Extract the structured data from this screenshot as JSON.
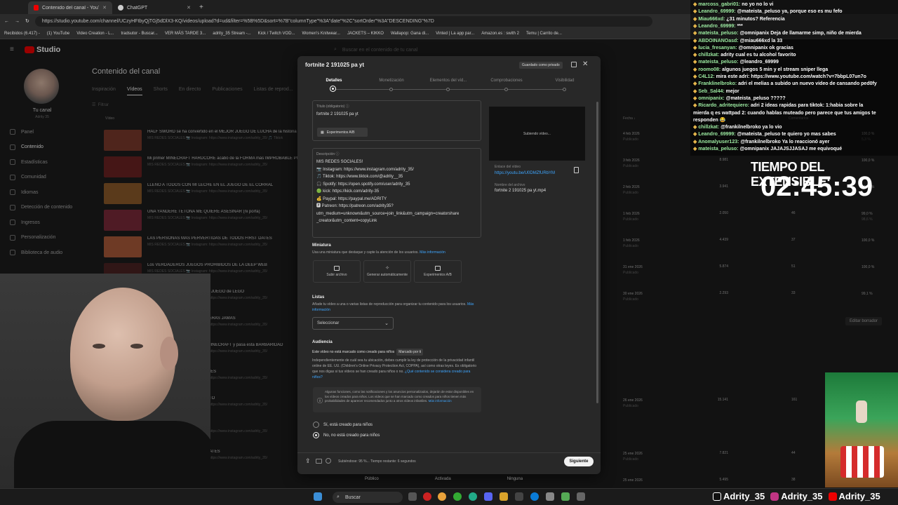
{
  "browser": {
    "tabs": [
      {
        "label": "Contenido del canal - YouTube St",
        "active": true
      },
      {
        "label": "ChatGPT",
        "active": false
      }
    ],
    "url": "https://studio.youtube.com/channel/UCzyHFtbyQjTGj5dDlX3-KQ/videos/upload?d=ud&filter=%5B%5D&sort=%7B\"columnType\"%3A\"date\"%2C\"sortOrder\"%3A\"DESCENDING\"%7D",
    "bookmarks": [
      "Recibidos (6.417) -",
      "(1) YouTube",
      "Video Creation - L...",
      "tradsutor - Buscar...",
      "VER MÁS TARDE 3...",
      "adrity_35 Stream -...",
      "Kick / Twitch VOD...",
      "Women's Knitwear...",
      "JACKETS – KIKKO",
      "Wallapop: Gana di...",
      "Vinted | La app par...",
      "Amazon.es : swith 2",
      "Temu | Carrito de..."
    ]
  },
  "studio": {
    "logo": "Studio",
    "search_placeholder": "Buscar en el contenido de tu canal",
    "channel_label": "Tu canal",
    "channel_name": "Adrity 35",
    "nav": [
      "Panel",
      "Contenido",
      "Estadísticas",
      "Comunidad",
      "Idiomas",
      "Detección de contenido",
      "Ingresos",
      "Personalización",
      "Biblioteca de audio"
    ],
    "page_title": "Contenido del canal",
    "subtabs": [
      "Inspiración",
      "Vídeos",
      "Shorts",
      "En directo",
      "Publicaciones",
      "Listas de reprod..."
    ],
    "filter_placeholder": "Filtrar",
    "col_video": "Vídeo",
    "col_date": "Fecha",
    "col_comments": "Comentarios",
    "edit_draft": "Editar borrador",
    "footer": [
      "Público",
      "Activada",
      "Ninguna"
    ],
    "videos": [
      {
        "title": "HALF SWORD se ha convertido en el MEJOR JUEGO DE LUCHA de la historia",
        "desc": "MIS REDES SOCIALES 📷 Instagram: https://www.instagram.com/adrity_35/ 🎵 Tiktok",
        "date": "4 feb 2026",
        "status": "Publicado",
        "views": "",
        "comments": "",
        "pct": "100,0 %",
        "pct_sub": "5,3 %",
        "thumb": "#7a3a2c",
        "duration": "23:56"
      },
      {
        "title": "Mi primer MINECRAFT HARDCORE acabó de la FORMA más IMPROBABLE POSIBLE",
        "desc": "MIS REDES SOCIALES 📷 Instagram: https://www.instagram.com/adrity_35/",
        "date": "3 feb 2026",
        "status": "Publicado",
        "views": "8.981",
        "comments": "",
        "pct": "100,0 %",
        "pct_sub": "",
        "thumb": "#6a2222",
        "duration": "1:08:42"
      },
      {
        "title": "LLENO A TODOS CON MI LECHE EN EL JUEGO DE EL CORRAL",
        "desc": "MIS REDES SOCIALES 📷 Instagram: https://www.instagram.com/adrity_35/",
        "date": "2 feb 2026",
        "status": "Publicado",
        "views": "3.941",
        "comments": "",
        "pct": "100,0 %",
        "pct_sub": "",
        "thumb": "#8a5a2a",
        "duration": "1:32:02"
      },
      {
        "title": "UNA YANDERE TETONA ME QUIERE ASESINAR (ni porfa)",
        "desc": "MIS REDES SOCIALES 📷 Instagram: https://www.instagram.com/adrity_35/",
        "date": "1 feb 2026",
        "status": "Publicado",
        "views": "2.050",
        "comments": "46",
        "pct": "99,0 %",
        "pct_sub": "98,6 %",
        "thumb": "#7a2a3a",
        "duration": "21:33"
      },
      {
        "title": "LAS PERSONAS MÁS PERVERTIDAS DE TODOS FIRST DATES",
        "desc": "MIS REDES SOCIALES 📷 Instagram: https://www.instagram.com/adrity_35/",
        "date": "1 feb 2026",
        "status": "Publicado",
        "views": "4.439",
        "comments": "37",
        "pct": "100,0 %",
        "pct_sub": "",
        "thumb": "#aa5a3a",
        "duration": "23:12"
      },
      {
        "title": "Los VERDADEROS JUEGOS PROHIBIDOS DE LA DEEP WEB",
        "desc": "MIS REDES SOCIALES 📷 Instagram: https://www.instagram.com/adrity_35/",
        "date": "31 ene 2026",
        "status": "Publicado",
        "views": "5.874",
        "comments": "51",
        "pct": "100,0 %",
        "pct_sub": "",
        "thumb": "#4a2222",
        "duration": "30:51"
      },
      {
        "title": "CAOS y DELINCUENCIA en este JUEGO de LEGO",
        "desc": "MIS REDES SOCIALES 📷 Instagram: https://www.instagram.com/adrity_35/",
        "date": "30 ene 2026",
        "status": "Publicado",
        "views": "2.293",
        "comments": "33",
        "pct": "99,1 %",
        "pct_sub": "",
        "thumb": "#5a4a2a",
        "duration": ""
      },
      {
        "title": "ROBOTS MÁS TENSIAS QUE VERÁS JAMÁS",
        "desc": "MIS REDES SOCIALES 📷 Instagram: https://www.instagram.com/adrity_35/",
        "date": "",
        "status": "",
        "views": "",
        "comments": "",
        "pct": "",
        "pct_sub": "",
        "thumb": "#333",
        "duration": ""
      },
      {
        "title": "PARA VER SI ES MEJOR QUE MINECRAFT y pasa esta BARBARIDAD",
        "desc": "MIS REDES SOCIALES 📷 Instagram: https://www.instagram.com/adrity_35/",
        "date": "",
        "status": "",
        "views": "",
        "comments": "",
        "pct": "",
        "pct_sub": "",
        "thumb": "#333",
        "duration": ""
      },
      {
        "title": "LOCA QUE HE IDO A FIRST DATES",
        "desc": "MIS REDES SOCIALES 📷 Instagram: https://www.instagram.com/adrity_35/",
        "date": "",
        "status": "",
        "views": "",
        "comments": "",
        "pct": "",
        "pct_sub": "",
        "thumb": "#333",
        "duration": ""
      },
      {
        "title": "HAKEAR CHAT GPT Y PASA ESTO",
        "desc": "MIS REDES SOCIALES 📷 Instagram: https://www.instagram.com/adrity_35/",
        "date": "26 ene 2026",
        "status": "Publicado",
        "views": "15.141",
        "comments": "161",
        "pct": "100,0 %",
        "pct_sub": "",
        "thumb": "#333",
        "duration": ""
      },
      {
        "title": "FSS demasiado BUENO",
        "desc": "MIS REDES SOCIALES 📷 Instagram: https://www.instagram.com/adrity_35/",
        "date": "",
        "status": "",
        "views": "",
        "comments": "",
        "pct": "",
        "pct_sub": "",
        "thumb": "#333",
        "duration": ""
      },
      {
        "title": "T3 T45 DE SU CITA EN FIRST DATES",
        "desc": "MIS REDES SOCIALES 📷 Instagram: https://www.instagram.com/adrity_35/",
        "date": "25 ene 2026",
        "status": "Publicado",
        "views": "7.821",
        "comments": "44",
        "pct": "100,0 %",
        "pct_sub": "",
        "thumb": "#333",
        "duration": ""
      },
      {
        "title": "QUE ALGO TE PERSIGUE",
        "desc": "",
        "date": "25 ene 2026",
        "status": "",
        "views": "5.495",
        "comments": "38",
        "pct": "100,0 %",
        "pct_sub": "",
        "thumb": "#333",
        "duration": ""
      }
    ]
  },
  "modal": {
    "title": "fortnite 2 191025 pa yt",
    "saved_badge": "Guardado como privado",
    "steps": [
      "Detalles",
      "Monetización",
      "Elementos del víd...",
      "Comprobaciones",
      "Visibilidad"
    ],
    "title_label": "Título (obligatorio)",
    "title_value": "fortnite 2  191025 pa yt",
    "ab_button": "Experimentos A/B",
    "desc_label": "Descripción",
    "desc_lines": [
      "MIS REDES SOCIALES!",
      "📷 Instagram: https://www.instagram.com/adrity_35/",
      "🎵 Tiktok: https://www.tiktok.com/@adrity__35",
      "🎧 Spotify: https://open.spotify.com/user/adrity_35",
      "🟢 kick: https://kick.com/adrity-35",
      "💰 Paypal: https://paypal.me/ADRITY",
      "🅿 Patreon: https://patreon.com/adrity35?",
      "utm_medium=unknown&utm_source=join_link&utm_campaign=creatorshare",
      "_creator&utm_content=copyLink"
    ],
    "preview_text": "Subiendo vídeo...",
    "video_link_label": "Enlace del vídeo",
    "video_link": "https://youtu.be/U0DMZfURbYM",
    "filename_label": "Nombre del archivo",
    "filename": "fortnite 2 191025 pa yt.mp4",
    "thumb_title": "Miniatura",
    "thumb_text": "Usa una miniatura que destaque y capte la atención de los usuarios.",
    "thumb_link": "Más información",
    "thumb_tiles": [
      "Subir archivo",
      "Generar automáticamente",
      "Experimentos A/B"
    ],
    "lists_title": "Listas",
    "lists_text": "Añade tu vídeo a una o varias listas de reproducción para organizar tu contenido para los usuarios.",
    "lists_link": "Más información",
    "select_label": "Seleccionar",
    "audience_title": "Audiencia",
    "audience_sub": "Este vídeo no está marcado como creado para niños",
    "audience_badge": "Marcado por ti",
    "audience_text": "Independientemente de cuál sea tu ubicación, debes cumplir la ley de protección de la privacidad infantil online de EE. UU. (Children's Online Privacy Protection Act, COPPA), así como otras leyes. Es obligatorio que nos digas si tus vídeos se han creado para niños o no.",
    "audience_link": "¿Qué contenido se considera creado para niños?",
    "info_text": "Algunas funciones, como las notificaciones y los anuncios personalizados, dejarán de estar disponibles en los vídeos creados para niños. Los vídeos que se han marcado como creados para niños tienen más probabilidades de aparecer recomendados junto a otros vídeos infantiles.",
    "info_link": "Más información",
    "radio_yes": "Sí, está creado para niños",
    "radio_no": "No, no está creado para niños",
    "upload_status": "Subiéndose: 95 %... Tiempo restante: 6 segundos",
    "next_button": "Siguiente"
  },
  "chat": [
    {
      "user": "marcoss_gabri01:",
      "msg": " no yo no lo vi"
    },
    {
      "user": "Leandro_69999:",
      "msg": " @mateista_peluso ya, porque eso es mu fefo"
    },
    {
      "user": "Miau666xd:",
      "msg": " ¿31 minutos? Referencia"
    },
    {
      "user": "Leandro_69999:",
      "msg": " ***"
    },
    {
      "user": "mateista_peluso:",
      "msg": " @omnipanix Deja de llamarme simp, niño de mierda"
    },
    {
      "user": "ABDOINANOasd:",
      "msg": " @miau666xd la 33"
    },
    {
      "user": "lucia_fresanyan:",
      "msg": " @omnipanix ok gracias"
    },
    {
      "user": "chillzkat:",
      "msg": " adrity cual es tu alcohol favorito"
    },
    {
      "user": "mateista_peluso:",
      "msg": " @leandro_69999"
    },
    {
      "user": "roomo08:",
      "msg": " algunos juegos 5 min y el stream sniper llega"
    },
    {
      "user": "C4L12:",
      "msg": " mira este adri: https://www.youtube.com/watch?v=7bbpL07un7o"
    },
    {
      "user": "Franklinelbroko:",
      "msg": " adri el melias a subido un nuevo video de cansando ped0fy"
    },
    {
      "user": "Seb_Sal44:",
      "msg": " mejor"
    },
    {
      "user": "omnipanix:",
      "msg": " @mateista_peluso ?????"
    },
    {
      "user": "Ricardo_adritequiero:",
      "msg": " adri 2 ideas rapidas para tiktok: 1:habia sobre la"
    },
    {
      "user": "",
      "msg": "mierda q es wattpad 2: cuando hablas muteado pero parece que tus amigos te"
    },
    {
      "user": "",
      "msg": "responden 😂"
    },
    {
      "user": "chillzkat:",
      "msg": " @frankilnelbroko ya lo vio"
    },
    {
      "user": "Leandro_69999:",
      "msg": " @mateista_peluso te quiero yo mas sabes"
    },
    {
      "user": "Anomalyuser123:",
      "msg": " @frankilnelbroko Ya lo reaccionó ayer"
    },
    {
      "user": "mateista_peluso:",
      "msg": " @omnipanix JAJAJSJJASAJ me equivoqué"
    }
  ],
  "timer": {
    "label": "TIEMPO DEL EXTENSIBLE:",
    "value": "02:45:39"
  },
  "taskbar": {
    "search": "Buscar"
  },
  "socials": [
    "Adrity_35",
    "Adrity_35",
    "Adrity_35"
  ]
}
